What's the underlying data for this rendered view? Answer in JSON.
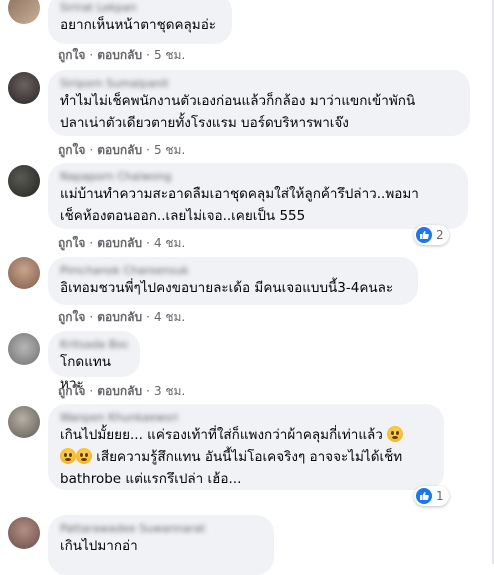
{
  "actions": {
    "like_label": "ถูกใจ",
    "reply_label": "ตอบกลับ",
    "separator": "·"
  },
  "comments": [
    {
      "author": "Sirirat Lekpan",
      "lines": [
        "อยากเห็นหน้าตาชุดคลุมอ่ะ"
      ],
      "time": "5 ชม."
    },
    {
      "author": "Siriporn Sumalpanit",
      "lines": [
        "ทำไมไม่เช็คพนักงานตัวเองก่อนแล้วก็กล้อง มาว่าแขกเข้าพักนิ",
        "ปลาเน่าตัวเดียวตายทั้งโรงแรม บอร์ดบริหารพาเจ๊ง"
      ],
      "time": "5 ชม."
    },
    {
      "author": "Napaporn Chaiwong",
      "lines": [
        "แม่บ้านทำความสะอาดลืมเอาชุดคลุมใส่ให้ลูกค้ารึปล่าว..พอมา",
        "เช็คห้องตอนออก..เลยไม่เจอ..เคยเป็น 555"
      ],
      "time": "4 ชม.",
      "reactions": "2"
    },
    {
      "author": "Pimchanok Charoensuk",
      "lines": [
        "อิเทอมชวนพี่ๆไปคงขอบายละเด้อ มีคนเจอแบบนี้3-4คนละ"
      ],
      "time": "4 ชม."
    },
    {
      "author": "Kritsada Boon",
      "lines": [
        "โกดแทนหวะ"
      ],
      "time": "3 ชม."
    },
    {
      "author": "Wanpen Khunkaewsri",
      "lines": [
        "เกินไปมั้ยยย... แค่รองเท้าที่ใส่ก็แพงกว่าผ้าคลุมกี่เท่าแล้ว",
        " เสียความรู้สึกแทน อันนี้ไม่โอเคจริงๆ อาจจะไม่ได้เช็ท",
        "bathrobe แต่แรกรึเปล่า เฮ้อ..."
      ],
      "time": "3 ชม.",
      "reactions": "1"
    },
    {
      "author": "Pattarawadee Suwannarat",
      "lines": [
        "เกินไปมากอ่า"
      ],
      "time": ""
    }
  ],
  "colors": {
    "bubble": "#f0f2f5",
    "meta": "#65676b",
    "text": "#050505",
    "like": "#1877f2"
  }
}
